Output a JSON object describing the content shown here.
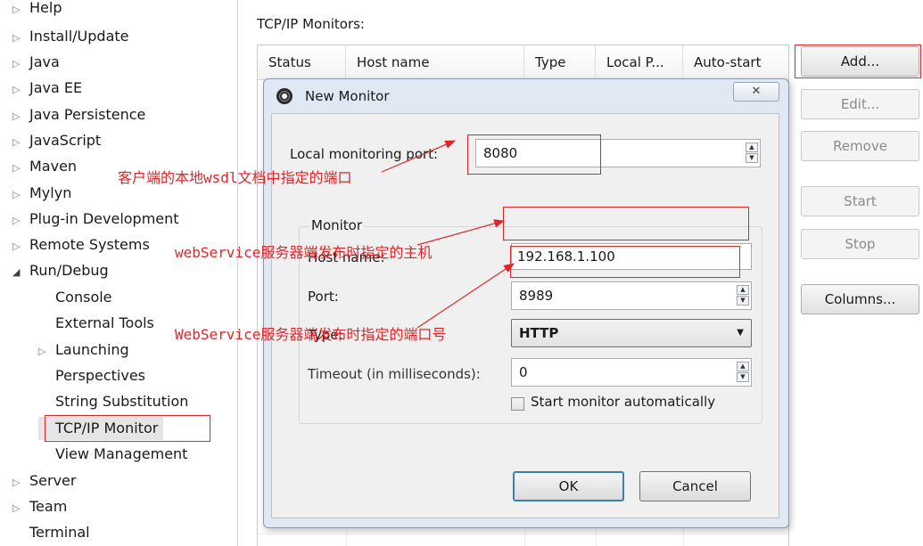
{
  "tree": {
    "items": [
      {
        "label": "Help",
        "arrow": "▷"
      },
      {
        "label": "Install/Update",
        "arrow": "▷"
      },
      {
        "label": "Java",
        "arrow": "▷"
      },
      {
        "label": "Java EE",
        "arrow": "▷"
      },
      {
        "label": "Java Persistence",
        "arrow": "▷"
      },
      {
        "label": "JavaScript",
        "arrow": "▷"
      },
      {
        "label": "Maven",
        "arrow": "▷"
      },
      {
        "label": "Mylyn",
        "arrow": "▷"
      },
      {
        "label": "Plug-in Development",
        "arrow": "▷"
      },
      {
        "label": "Remote Systems",
        "arrow": "▷"
      },
      {
        "label": "Run/Debug",
        "arrow": "◢"
      }
    ],
    "children": [
      {
        "label": "Console",
        "arrow": ""
      },
      {
        "label": "External Tools",
        "arrow": ""
      },
      {
        "label": "Launching",
        "arrow": "▷"
      },
      {
        "label": "Perspectives",
        "arrow": ""
      },
      {
        "label": "String Substitution",
        "arrow": ""
      },
      {
        "label": "TCP/IP Monitor",
        "arrow": ""
      },
      {
        "label": "View Management",
        "arrow": ""
      }
    ],
    "after": [
      {
        "label": "Server",
        "arrow": "▷"
      },
      {
        "label": "Team",
        "arrow": "▷"
      },
      {
        "label": "Terminal",
        "arrow": ""
      }
    ]
  },
  "panel": {
    "title": "TCP/IP Monitors:",
    "columns": [
      "Status",
      "Host name",
      "Type",
      "Local P...",
      "Auto-start"
    ],
    "buttons": {
      "add": "Add...",
      "edit": "Edit...",
      "remove": "Remove",
      "start": "Start",
      "stop": "Stop",
      "columns": "Columns..."
    }
  },
  "dialog": {
    "title": "New Monitor",
    "close_label": "✕",
    "local_port_label": "Local monitoring port:",
    "local_port_value": "8080",
    "group_label": "Monitor",
    "host_label": "Host name:",
    "host_value": "192.168.1.100",
    "port_label": "Port:",
    "port_value": "8989",
    "type_label": "Type:",
    "type_value": "HTTP",
    "timeout_label": "Timeout (in milliseconds):",
    "timeout_value": "0",
    "auto_start_label": "Start monitor automatically",
    "auto_start_checked": false,
    "ok": "OK",
    "cancel": "Cancel"
  },
  "annotations": {
    "local_port": "客户端的本地wsdl文档中指定的端口",
    "host": "webService服务器端发布时指定的主机",
    "port": "WebService服务器端发布时指定的端口号"
  },
  "colors": {
    "annotation": "#e0262a",
    "dialog_frame": "#dfe8f3"
  }
}
